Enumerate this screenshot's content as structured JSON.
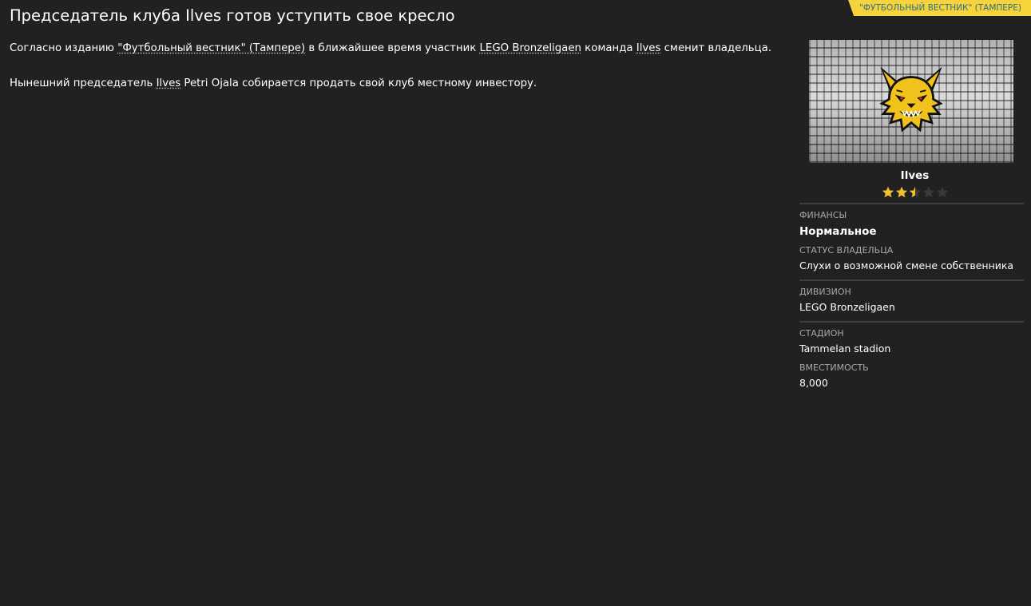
{
  "source_tag": "\"ФУТБОЛЬНЫЙ ВЕСТНИК\" (ТАМПЕРЕ)",
  "headline": "Председатель клуба Ilves готов уступить свое кресло",
  "article": {
    "p1": {
      "pre": "Согласно изданию ",
      "source_link": "\"Футбольный вестник\" (Тампере)",
      "mid1": " в ближайшее время участник ",
      "league_link": "LEGO Bronzeligaen",
      "mid2": " команда ",
      "club_link": "Ilves",
      "post": " сменит владельца."
    },
    "p2": {
      "pre": "Нынешний председатель ",
      "club_link": "Ilves",
      "post": " Petri Ojala собирается продать свой клуб местному инвестору."
    }
  },
  "club": {
    "name": "Ilves",
    "rating": 2.5,
    "rating_max": 5,
    "star_color": "#f2c12e",
    "star_empty_color": "#3a3a3a",
    "logo_icon": "lynx-crest-icon"
  },
  "details": {
    "finance_label": "ФИНАНСЫ",
    "finance_value": "Нормальное",
    "owner_status_label": "СТАТУС ВЛАДЕЛЬЦА",
    "owner_status_value": "Слухи о возможной смене собственника",
    "division_label": "ДИВИЗИОН",
    "division_value": "LEGO Bronzeligaen",
    "stadium_label": "СТАДИОН",
    "stadium_value": "Tammelan stadion",
    "capacity_label": "ВМЕСТИМОСТЬ",
    "capacity_value": "8,000"
  },
  "colors": {
    "background": "#212121",
    "accent_yellow": "#f6d33a",
    "tag_text": "#2c6e8e"
  }
}
